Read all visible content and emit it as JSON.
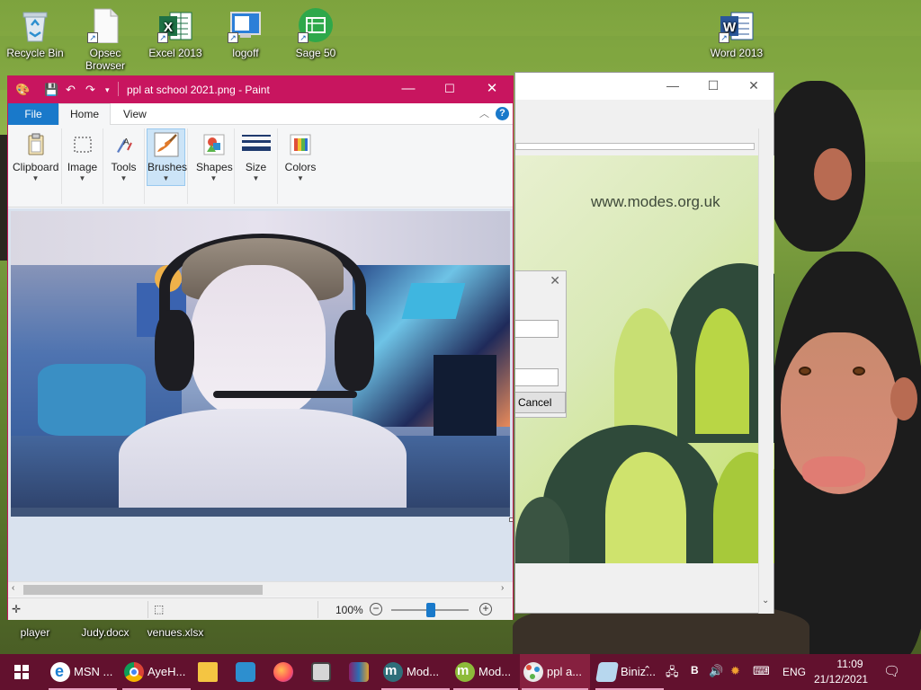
{
  "desktop": {
    "icons": [
      {
        "label": "Recycle Bin"
      },
      {
        "label": "Opsec Browser"
      },
      {
        "label": "Excel 2013"
      },
      {
        "label": "logoff"
      },
      {
        "label": "Sage 50"
      },
      {
        "label": "Word 2013"
      }
    ],
    "bottom_icons": [
      {
        "label": "player"
      },
      {
        "label": "Judy.docx"
      },
      {
        "label": "venues.xlsx"
      }
    ]
  },
  "bg_window": {
    "url_text": "www.modes.org.uk",
    "cancel_label": "Cancel",
    "colors": {
      "accent_dark": "#2f4a3a",
      "accent_lime": "#b9d645"
    }
  },
  "paint": {
    "title": "ppl at school 2021.png - Paint",
    "tabs": {
      "file": "File",
      "home": "Home",
      "view": "View"
    },
    "ribbon": [
      {
        "label": "Clipboard",
        "icon": "clipboard-icon"
      },
      {
        "label": "Image",
        "icon": "select-icon"
      },
      {
        "label": "Tools",
        "icon": "tools-icon"
      },
      {
        "label": "Brushes",
        "icon": "brush-icon",
        "active": true
      },
      {
        "label": "Shapes",
        "icon": "shapes-icon"
      },
      {
        "label": "Size",
        "icon": "size-icon"
      },
      {
        "label": "Colors",
        "icon": "colors-icon"
      }
    ],
    "status": {
      "zoom": "100%"
    },
    "colors": {
      "titlebar": "#c8155f",
      "file_tab": "#1979ca"
    }
  },
  "taskbar": {
    "items": [
      {
        "label": "MSN ...",
        "icon": "ie-icon"
      },
      {
        "label": "AyeH...",
        "icon": "chrome-icon"
      },
      {
        "label": "Mod...",
        "icon": "modes-icon"
      },
      {
        "label": "Mod...",
        "icon": "modes-icon"
      },
      {
        "label": "ppl a...",
        "icon": "paint-icon"
      },
      {
        "label": "Biniz...",
        "icon": "notepad-icon"
      }
    ],
    "tray": {
      "language": "ENG",
      "badge": "B"
    },
    "clock": {
      "time": "11:09",
      "date": "21/12/2021"
    },
    "colors": {
      "background": "#62112e"
    }
  }
}
